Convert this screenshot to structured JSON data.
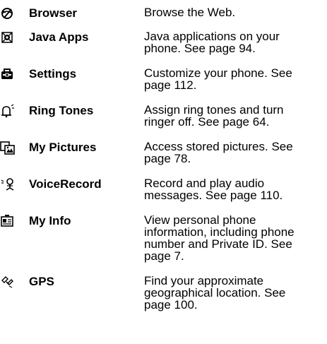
{
  "items": [
    {
      "icon": "browser-globe-icon",
      "name": "Browser",
      "lines": [
        "Browse the Web."
      ]
    },
    {
      "icon": "java-apps-icon",
      "name": "Java Apps",
      "lines": [
        "Java applications on your",
        "phone. See page 94."
      ]
    },
    {
      "icon": "settings-toolbox-icon",
      "name": "Settings",
      "lines": [
        "Customize your phone. See",
        "page 112."
      ]
    },
    {
      "icon": "ring-tones-bell-icon",
      "name": "Ring Tones",
      "lines": [
        "Assign ring tones and turn",
        "ringer off. See page 64."
      ]
    },
    {
      "icon": "my-pictures-icon",
      "name": "My Pictures",
      "lines": [
        "Access stored pictures. See",
        "page 78."
      ]
    },
    {
      "icon": "voice-record-icon",
      "name": "VoiceRecord",
      "lines": [
        "Record and play audio",
        "messages. See page 110."
      ]
    },
    {
      "icon": "my-info-card-icon",
      "name": "My Info",
      "lines": [
        "View personal phone",
        "information, including phone",
        "number and Private ID. See",
        "page 7."
      ]
    },
    {
      "icon": "gps-satellite-icon",
      "name": "GPS",
      "lines": [
        "Find your approximate",
        "geographical location. See",
        "page 100."
      ]
    }
  ]
}
